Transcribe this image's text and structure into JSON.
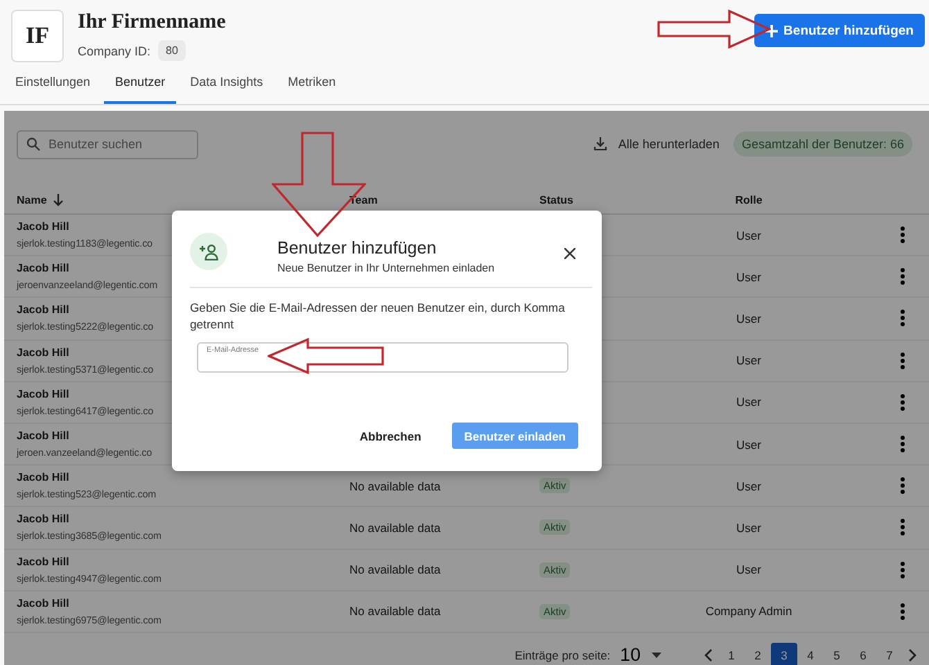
{
  "company": {
    "logo": "IF",
    "name": "Ihr Firmenname",
    "id_label": "Company ID:",
    "id": "80"
  },
  "add_button": {
    "label": "Benutzer hinzufügen"
  },
  "tabs": [
    {
      "label": "Einstellungen",
      "selected": false
    },
    {
      "label": "Benutzer",
      "selected": true
    },
    {
      "label": "Data Insights",
      "selected": false
    },
    {
      "label": "Metriken",
      "selected": false
    }
  ],
  "toolbar": {
    "search": {
      "placeholder": "Benutzer suchen"
    },
    "download": "Alle herunterladen",
    "total_badge": "Gesamtzahl der Benutzer: 66"
  },
  "table": {
    "columns": [
      {
        "label": "Name",
        "sorted": true
      },
      {
        "label": "Team",
        "sorted": false
      },
      {
        "label": "Status",
        "sorted": false
      },
      {
        "label": "Rolle",
        "sorted": false
      }
    ],
    "rows": [
      {
        "name": "Jacob Hill",
        "email": "sjerlok.testing1183@legentic.co",
        "role": "User"
      },
      {
        "name": "Jacob Hill",
        "email": "jeroenvanzeeland@legentic.com",
        "role": "User"
      },
      {
        "name": "Jacob Hill",
        "email": "sjerlok.testing5222@legentic.co",
        "role": "User"
      },
      {
        "name": "Jacob Hill",
        "email": "sjerlok.testing5371@legentic.co",
        "role": "User"
      },
      {
        "name": "Jacob Hill",
        "email": "sjerlok.testing6417@legentic.co",
        "role": "User"
      },
      {
        "name": "Jacob Hill",
        "email": "jeroen.vanzeeland@legentic.co",
        "role": "User"
      },
      {
        "name": "Jacob Hill",
        "email": "sjerlok.testing523@legentic.com",
        "team": "No available data",
        "status": "Aktiv",
        "role": "User"
      },
      {
        "name": "Jacob Hill",
        "email": "sjerlok.testing3685@legentic.com",
        "team": "No available data",
        "status": "Aktiv",
        "role": "User"
      },
      {
        "name": "Jacob Hill",
        "email": "sjerlok.testing4947@legentic.com",
        "team": "No available data",
        "status": "Aktiv",
        "role": "User"
      },
      {
        "name": "Jacob Hill",
        "email": "sjerlok.testing6975@legentic.com",
        "team": "No available data",
        "status": "Aktiv",
        "role": "Company Admin"
      }
    ]
  },
  "pagination": {
    "per_page_label": "Einträge pro seite:",
    "per_page": "10",
    "pages": [
      {
        "label": "1",
        "selected": false
      },
      {
        "label": "2",
        "selected": false
      },
      {
        "label": "3",
        "selected": true
      },
      {
        "label": "4",
        "selected": false
      },
      {
        "label": "5",
        "selected": false
      },
      {
        "label": "6",
        "selected": false
      },
      {
        "label": "7",
        "selected": false
      }
    ]
  },
  "dialog": {
    "title": "Benutzer hinzufügen",
    "subtitle": "Neue Benutzer in Ihr Unternehmen einladen",
    "instruction": "Geben Sie die E-Mail-Adressen der neuen Benutzer ein, durch Komma getrennt",
    "field": {
      "label": "E-Mail-Adresse"
    },
    "buttons": [
      {
        "label": "Abbrechen",
        "kind": "secondary"
      },
      {
        "label": "Benutzer einladen",
        "kind": "primary"
      }
    ]
  },
  "annotations": [
    {
      "kind": "right-arrow"
    },
    {
      "kind": "down-arrow"
    },
    {
      "kind": "left-arrow"
    }
  ]
}
